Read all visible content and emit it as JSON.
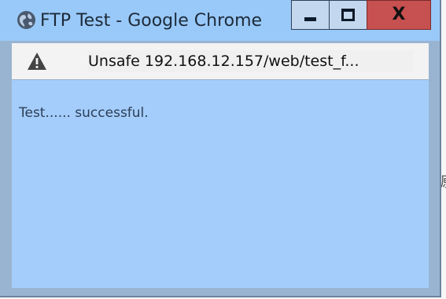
{
  "window": {
    "title": "FTP Test - Google Chrome",
    "controls": {
      "minimize_icon": "minimize-icon",
      "maximize_icon": "maximize-icon",
      "close_label": "X"
    }
  },
  "addressbar": {
    "security_icon": "warning-icon",
    "url_display": "Unsafe 192.168.12.157/web/test_f..."
  },
  "page": {
    "message": "Test...... successful."
  },
  "background": {
    "glyph_left": ":",
    "glyph_right": "源"
  },
  "colors": {
    "titlebar": "#99c9f9",
    "content": "#a4cdfb",
    "close_button": "#c75050",
    "warning_icon": "#444444"
  }
}
